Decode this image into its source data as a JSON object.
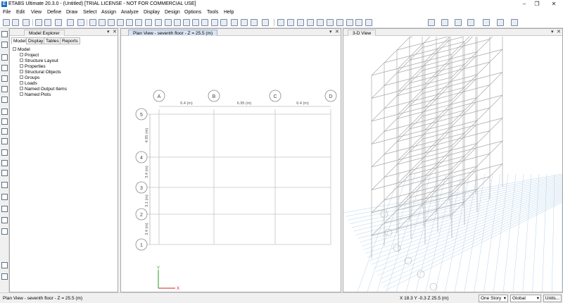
{
  "window": {
    "title": "ETABS Ultimate 20.3.0 - (Untitled)  [TRIAL LICENSE - NOT FOR COMMERCIAL USE]",
    "logo_letter": "E"
  },
  "menu": [
    "File",
    "Edit",
    "View",
    "Define",
    "Draw",
    "Select",
    "Assign",
    "Analyze",
    "Display",
    "Design",
    "Options",
    "Tools",
    "Help"
  ],
  "model_explorer": {
    "title": "Model Explorer",
    "tabs": [
      "Model",
      "Display",
      "Tables",
      "Reports"
    ],
    "active_tab": "Model",
    "tree_root": "Model",
    "tree_items": [
      "Project",
      "Structure Layout",
      "Properties",
      "Structural Objects",
      "Groups",
      "Loads",
      "Named Output Items",
      "Named Plots"
    ]
  },
  "plan_view": {
    "title": "Plan View - seventh floor - Z = 25.5 (m)",
    "grid_x_labels": [
      "A",
      "B",
      "C",
      "D"
    ],
    "grid_y_labels": [
      "5",
      "4",
      "3",
      "2",
      "1"
    ],
    "x_dims": [
      "6.4 (m)",
      "6.95 (m)",
      "6.4 (m)"
    ],
    "y_dims": [
      "4.95 (m)",
      "3.4 (m)",
      "3.1 (m)",
      "3.4 (m)"
    ],
    "axis_x": "X",
    "axis_y": "Y"
  },
  "view_3d": {
    "title": "3-D View"
  },
  "status": {
    "text": "Plan View - seventh floor - Z = 25.5 (m)",
    "coords": "X 18.3  Y -0.3  Z 25.5 (m)",
    "story_select": "One Story",
    "coord_select": "Global",
    "units_button": "Units..."
  }
}
